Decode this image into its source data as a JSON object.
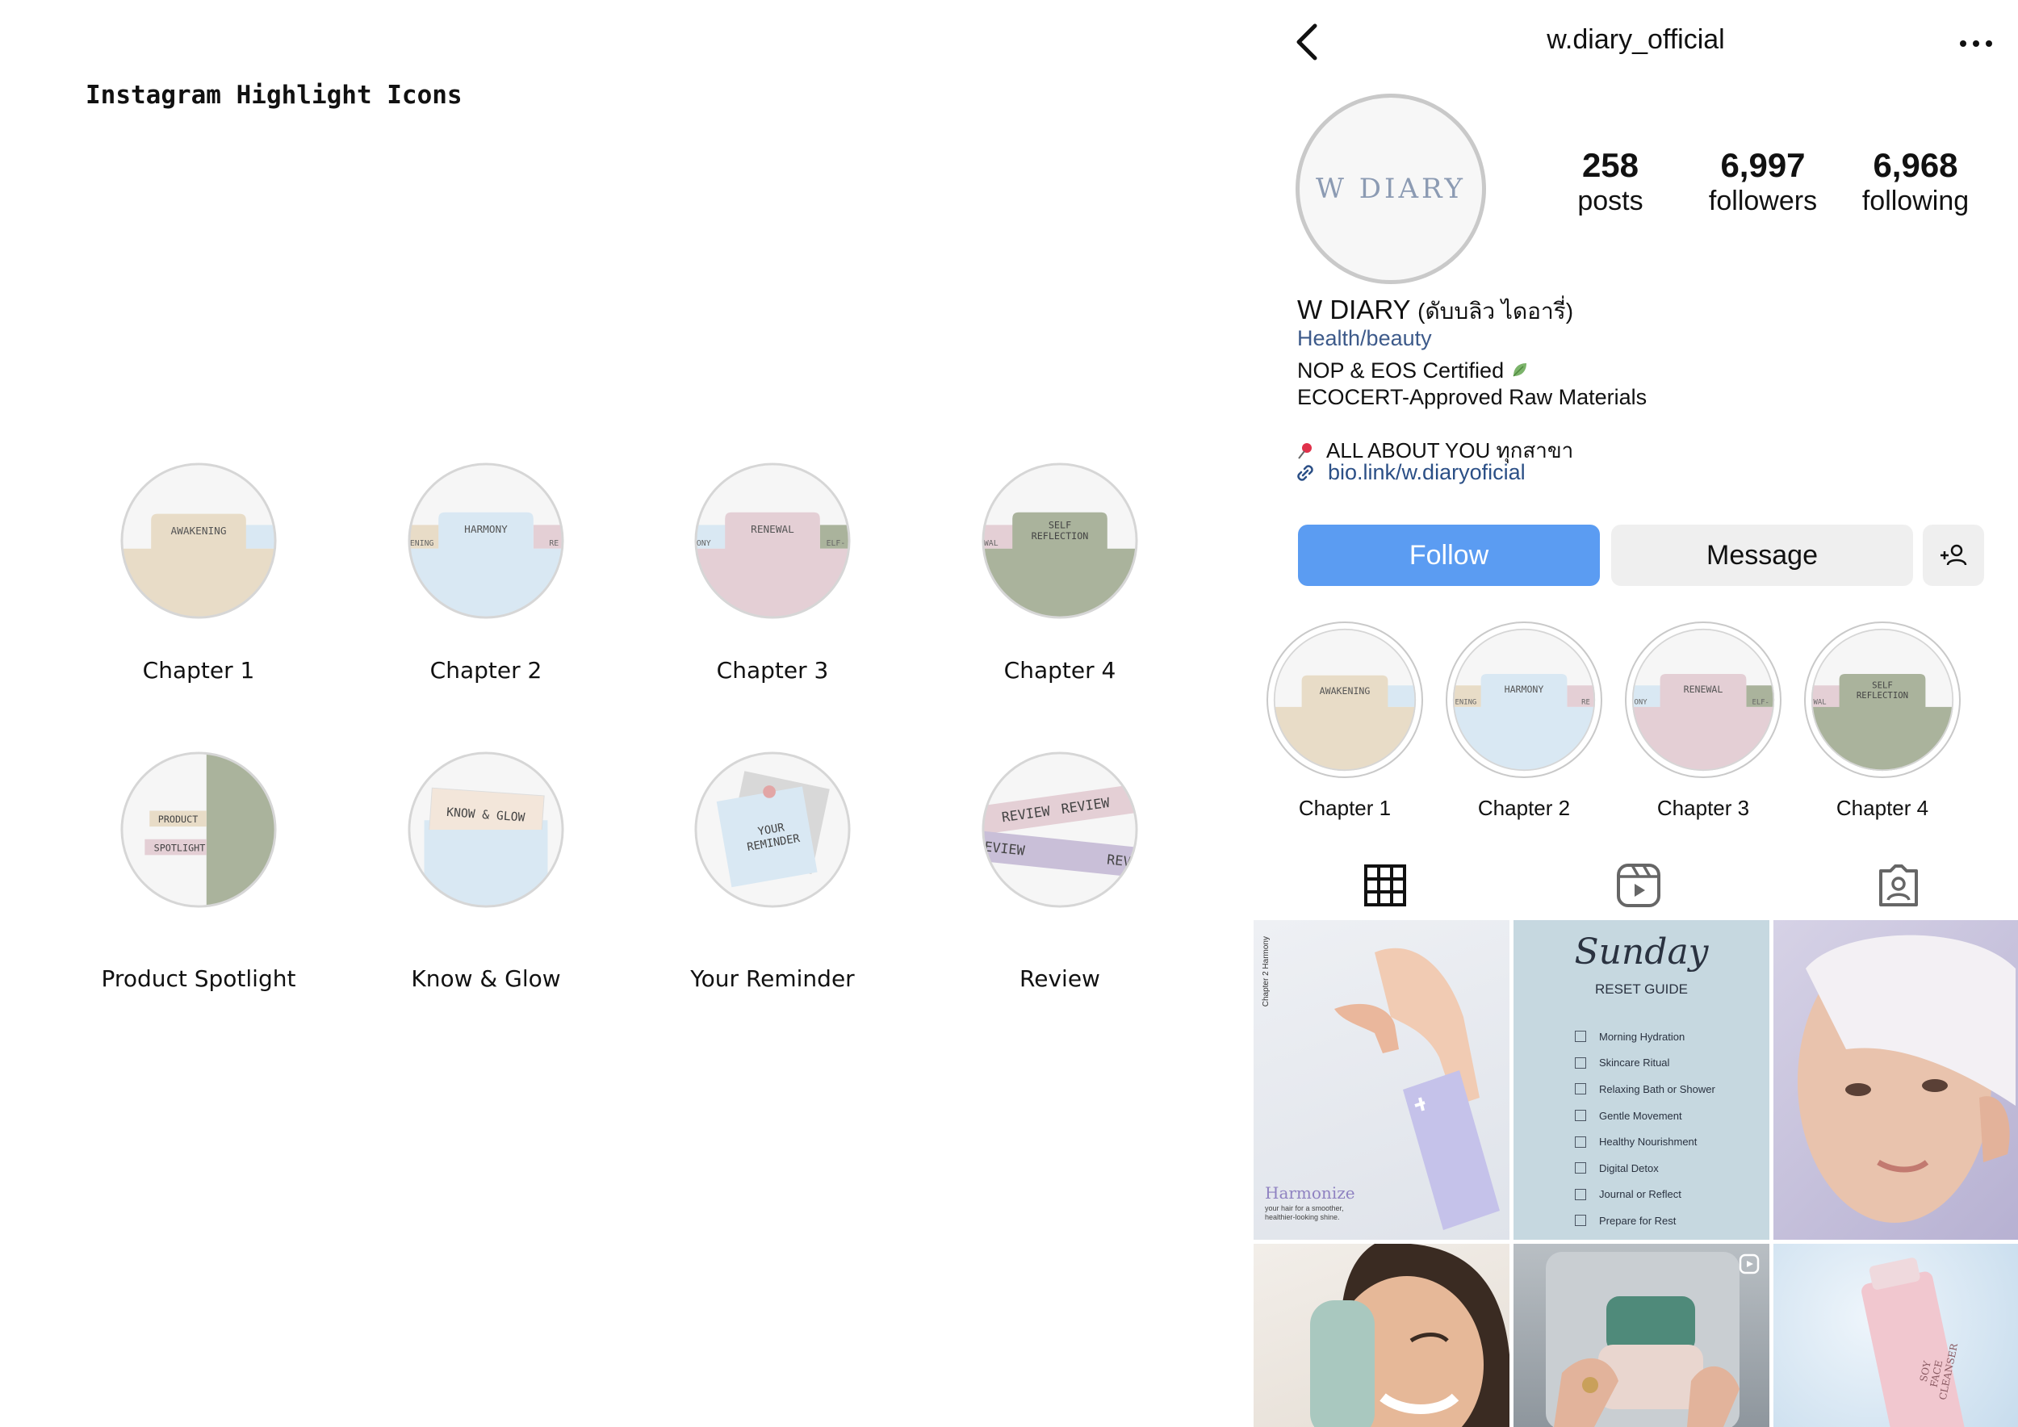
{
  "presentation": {
    "title": "Instagram Highlight Icons",
    "highlights": [
      {
        "caption": "Chapter 1",
        "tab_label": "AWAKENING"
      },
      {
        "caption": "Chapter 2",
        "tab_label": "HARMONY",
        "left_tab": "ENING",
        "right_tab": "RE"
      },
      {
        "caption": "Chapter 3",
        "tab_label": "RENEWAL",
        "left_tab": "ONY",
        "right_tab": "ELF-"
      },
      {
        "caption": "Chapter 4",
        "tab_label_1": "SELF",
        "tab_label_2": "REFLECTION",
        "left_tab": "WAL"
      },
      {
        "caption": "Product Spotlight",
        "label_1": "PRODUCT",
        "label_2": "SPOTLIGHT"
      },
      {
        "caption": "Know & Glow",
        "label": "KNOW & GLOW"
      },
      {
        "caption": "Your Reminder",
        "label_1": "YOUR",
        "label_2": "REMINDER"
      },
      {
        "caption": "Review",
        "label_a": "REVIEW",
        "label_b": "REVIEW",
        "label_c": "REVIEW",
        "label_d": "REV"
      }
    ]
  },
  "colors": {
    "beige": "#e8dcc7",
    "blue": "#d9e8f3",
    "pink": "#e4cfd5",
    "sage": "#aab39c",
    "lavender": "#c9bfd8",
    "follow": "#5b9cf2",
    "link": "#2b4f86"
  },
  "profile": {
    "username": "w.diary_official",
    "avatar_text": "W DIARY",
    "stats": [
      {
        "num": "258",
        "label": "posts"
      },
      {
        "num": "6,997",
        "label": "followers"
      },
      {
        "num": "6,968",
        "label": "following"
      }
    ],
    "name": "W DIARY",
    "name_thai": "(ดับบลิว ไดอารี่)",
    "category": "Health/beauty",
    "bio_line_1": "NOP & EOS Certified",
    "bio_line_2": "ECOCERT-Approved Raw Materials",
    "tagline": "ALL ABOUT YOU ทุกสาขา",
    "link": "bio.link/w.diaryoficial",
    "follow_label": "Follow",
    "message_label": "Message",
    "highlights": [
      {
        "caption": "Chapter 1",
        "tab_label": "AWAKENING"
      },
      {
        "caption": "Chapter 2",
        "tab_label": "HARMONY",
        "left_tab": "ENING",
        "right_tab": "RE"
      },
      {
        "caption": "Chapter 3",
        "tab_label": "RENEWAL",
        "left_tab": "ONY",
        "right_tab": "ELF-"
      },
      {
        "caption": "Chapter 4",
        "tab_label_1": "SELF",
        "tab_label_2": "REFLECTION",
        "left_tab": "WAL"
      }
    ]
  },
  "posts": {
    "p1_side": "Chapter 2 Harmony",
    "p1_title": "Harmonize",
    "p1_sub_1": "your hair for a smoother,",
    "p1_sub_2": "healthier-looking shine.",
    "p2_title": "Sunday",
    "p2_subtitle": "RESET GUIDE",
    "p2_items": [
      "Morning Hydration",
      "Skincare Ritual",
      "Relaxing Bath or Shower",
      "Gentle Movement",
      "Healthy Nourishment",
      "Digital Detox",
      "Journal or Reflect",
      "Prepare for Rest"
    ],
    "p6_text": "SOY FACE CLEANSER"
  },
  "icons": {
    "back": "chevron-left-icon",
    "more": "more-horizontal-icon",
    "grid": "grid-icon",
    "reels": "reels-icon",
    "tagged": "tagged-icon",
    "add_person": "add-person-icon",
    "link": "link-icon",
    "pin": "pin-icon",
    "leaf": "leaf-icon"
  }
}
